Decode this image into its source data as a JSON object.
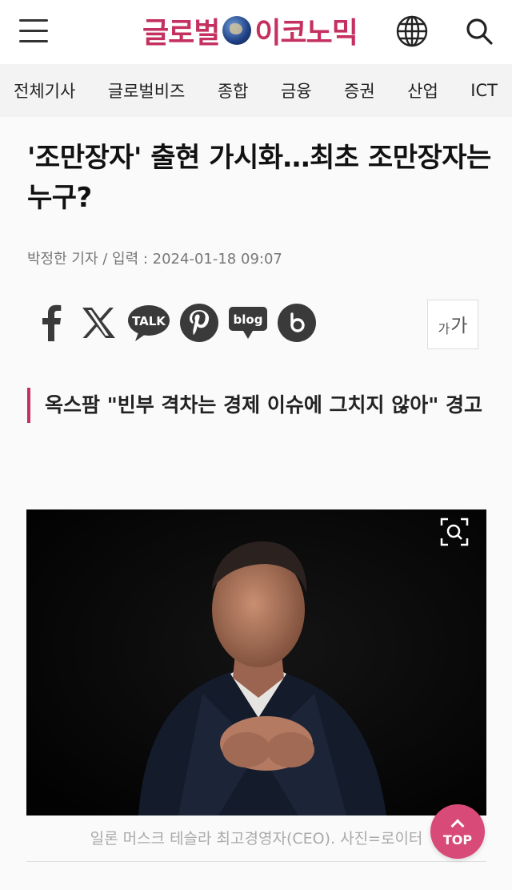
{
  "header": {
    "logo_parts": [
      "글로벌",
      "이코노믹"
    ],
    "brand_color": "#c4305f",
    "icons": [
      "menu-icon",
      "globe-icon",
      "search-icon"
    ]
  },
  "nav": {
    "items": [
      {
        "label": "전체기사"
      },
      {
        "label": "글로벌비즈"
      },
      {
        "label": "종합"
      },
      {
        "label": "금융"
      },
      {
        "label": "증권"
      },
      {
        "label": "산업"
      },
      {
        "label": "ICT"
      }
    ]
  },
  "article": {
    "headline": "'조만장자' 출현 가시화…최초 조만장자는 누구?",
    "byline": "박정한 기자 / 입력 : 2024-01-18 09:07",
    "share": {
      "kakao_label": "TALK",
      "blog_label": "blog",
      "font_small": "가",
      "font_big": "가"
    },
    "subheading": "옥스팜 \"빈부 격차는 경제 이슈에 그치지 않아\" 경고",
    "photo_caption": "일론 머스크 테슬라 최고경영자(CEO). 사진=로이터"
  },
  "top_button": {
    "label": "TOP"
  }
}
